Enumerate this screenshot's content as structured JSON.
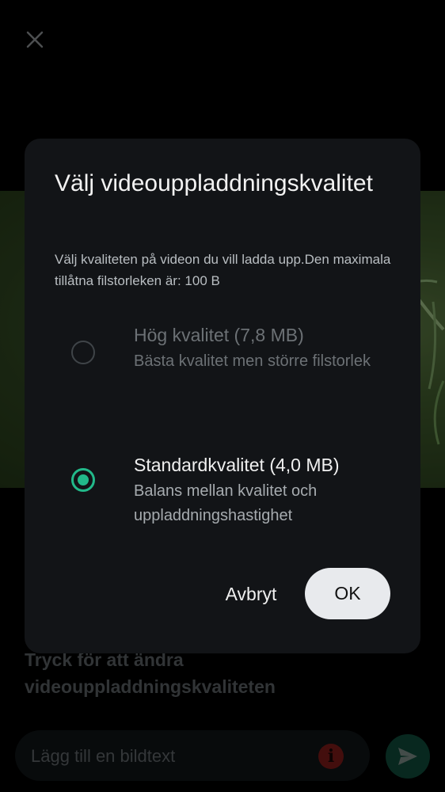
{
  "background": {
    "tap_hint": "Tryck för att ändra videouppladdningskvaliteten",
    "caption_placeholder": "Lägg till en bildtext",
    "info_icon_glyph": "i"
  },
  "dialog": {
    "title": "Välj videouppladdningskvalitet",
    "description": "Välj kvaliteten på videon du vill ladda upp.Den maximala tillåtna filstorleken är: 100 B",
    "options": [
      {
        "title": "Hög kvalitet (7,8 MB)",
        "subtitle": "Bästa kvalitet men större filstorlek",
        "selected": false
      },
      {
        "title": "Standardkvalitet (4,0 MB)",
        "subtitle": "Balans mellan kvalitet och uppladdningshastighet",
        "selected": true
      }
    ],
    "cancel_label": "Avbryt",
    "ok_label": "OK"
  },
  "colors": {
    "accent": "#22b98a",
    "dialog_bg": "#121417",
    "ok_button_bg": "#e8eaed",
    "send_button_bg": "#0f4a39",
    "info_icon_bg": "#7b1a18"
  },
  "icons": [
    "close-icon",
    "info-icon",
    "send-icon",
    "radio-unchecked-icon",
    "radio-checked-icon"
  ]
}
